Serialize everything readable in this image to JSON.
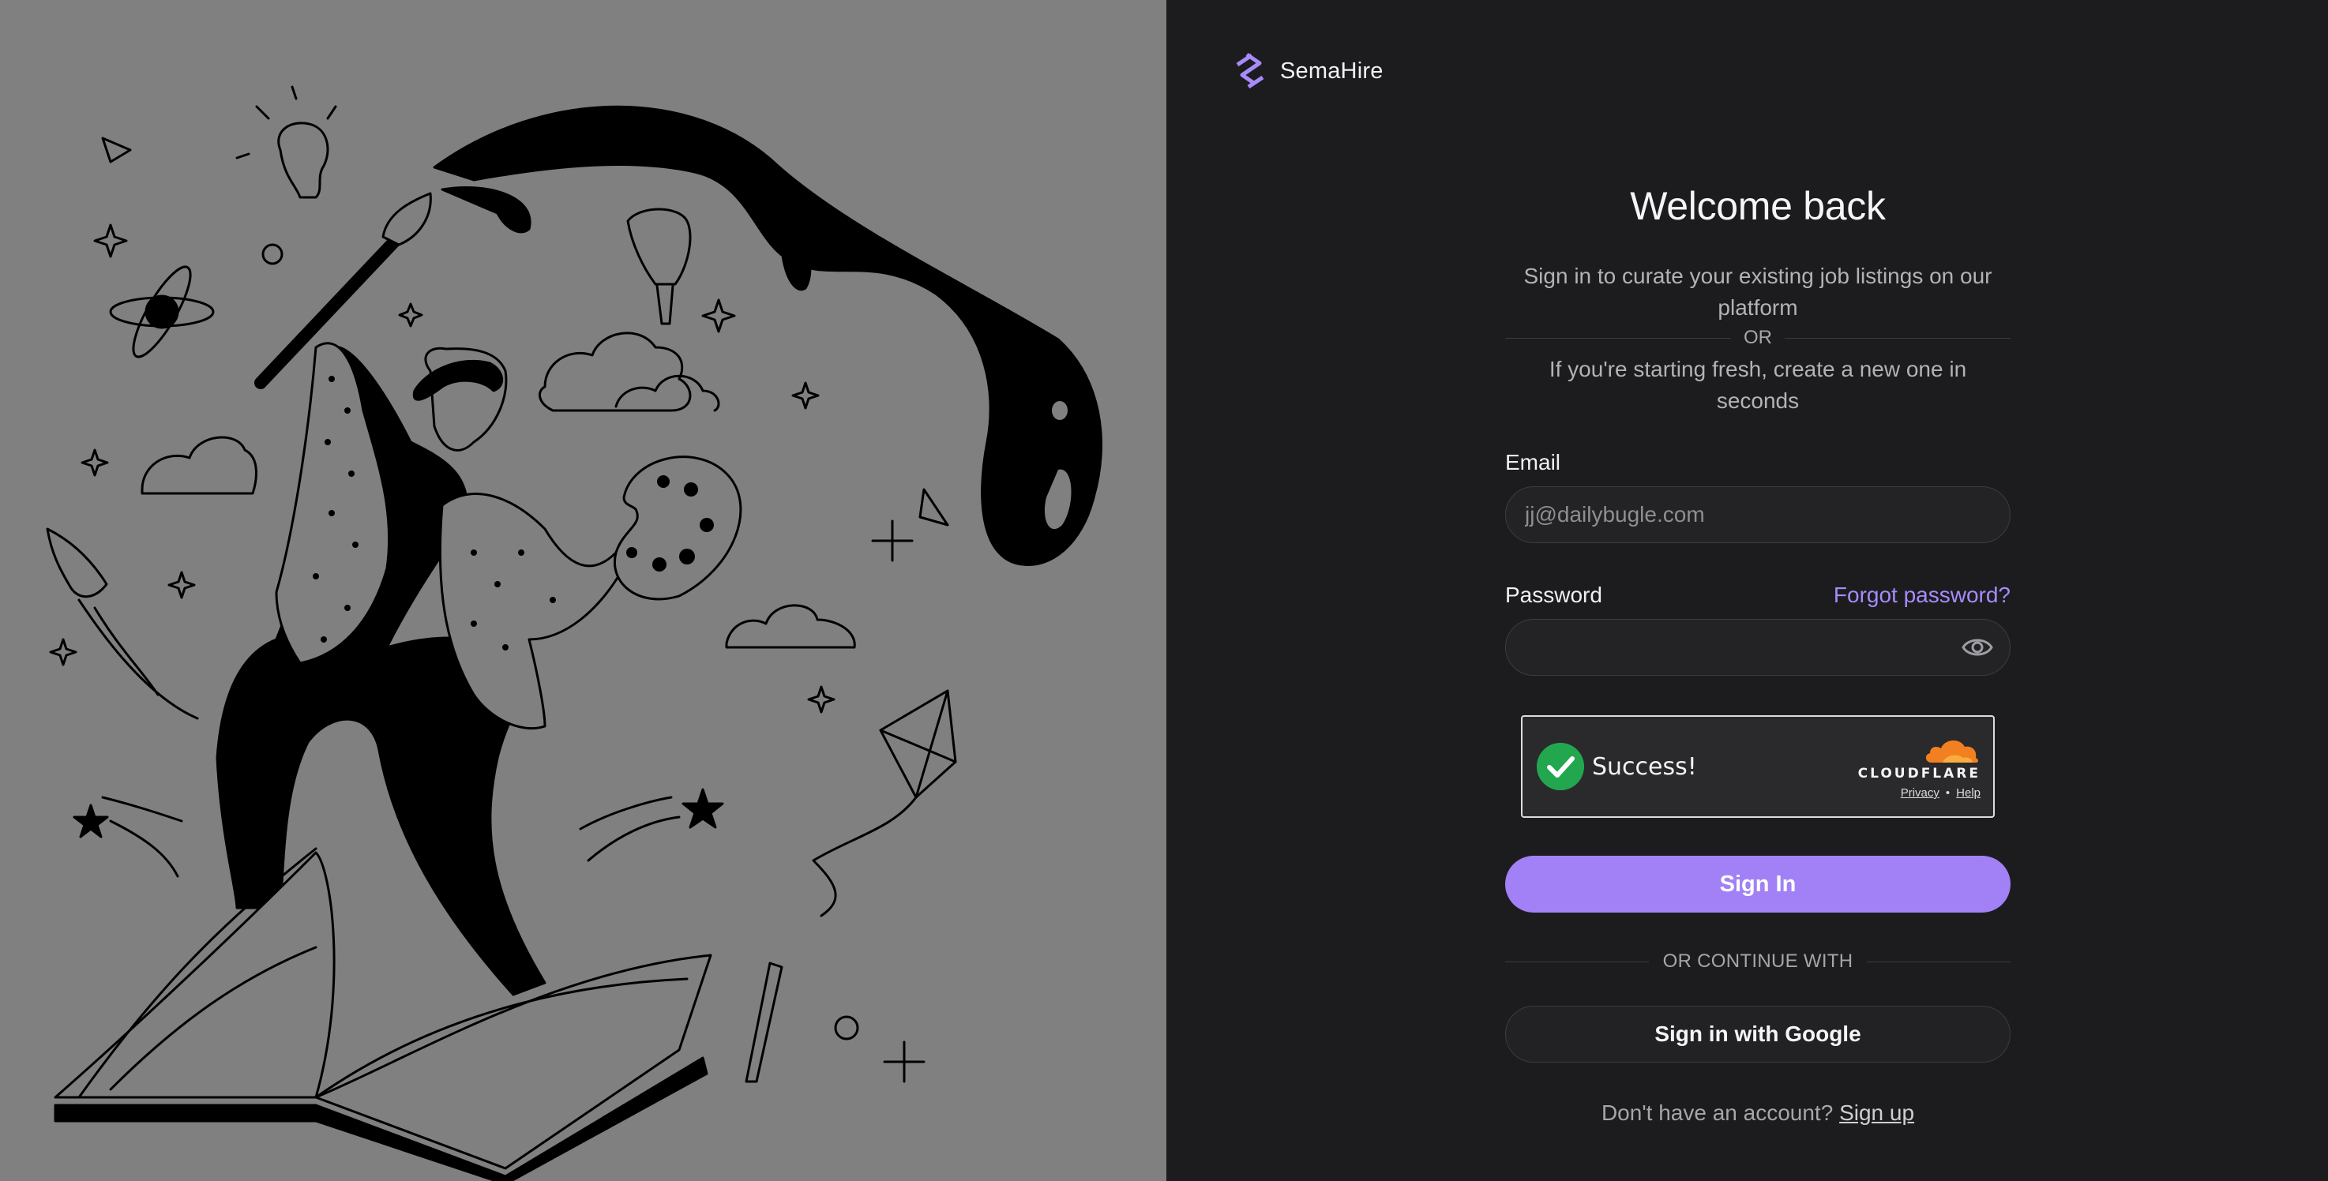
{
  "brand": {
    "name": "SemaHire"
  },
  "login": {
    "title": "Welcome back",
    "subtitle": "Sign in to curate your existing job listings on our platform",
    "or_label": "OR",
    "subtitle2": "If you're starting fresh, create a new one in seconds",
    "email_label": "Email",
    "email_placeholder": "jj@dailybugle.com",
    "email_value": "",
    "password_label": "Password",
    "forgot_label": "Forgot password?",
    "password_value": "",
    "signin_label": "Sign In",
    "continue_label": "OR CONTINUE WITH",
    "google_label": "Sign in with Google",
    "no_account_text": "Don't have an account?",
    "signup_label": "Sign up"
  },
  "captcha": {
    "status": "Success!",
    "provider": "CLOUDFLARE",
    "privacy_label": "Privacy",
    "separator": "•",
    "help_label": "Help"
  },
  "colors": {
    "accent": "#a181f5",
    "link": "#a78bfa",
    "left_panel_bg": "#808080",
    "right_panel_bg": "#1c1c1e",
    "captcha_success": "#22a74f",
    "cloudflare_orange": "#f38020"
  },
  "icons": {
    "brand": "semahire-logo-icon",
    "password_toggle": "eye-icon",
    "captcha_status": "checkmark-icon",
    "captcha_brand": "cloudflare-cloud-icon"
  }
}
